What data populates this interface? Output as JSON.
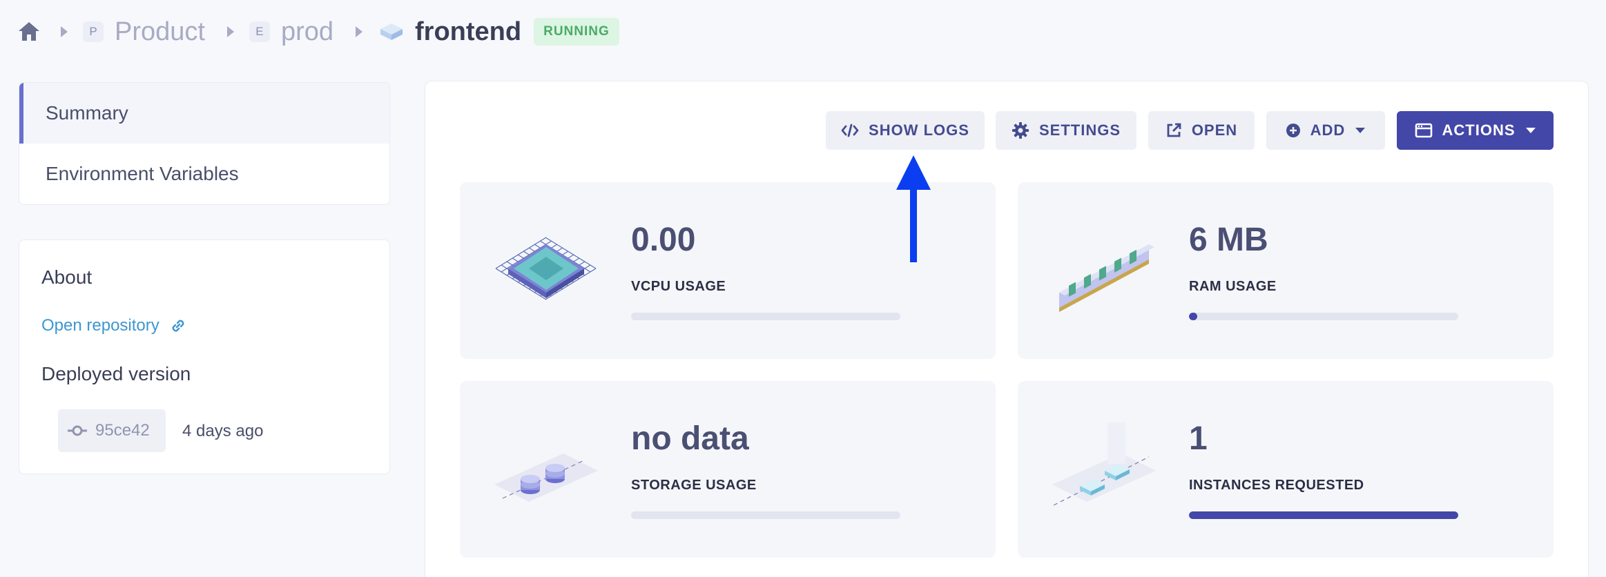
{
  "breadcrumb": {
    "project_letter": "P",
    "project": "Product",
    "env_letter": "E",
    "env": "prod",
    "service": "frontend",
    "status": "RUNNING"
  },
  "nav": {
    "items": [
      {
        "label": "Summary",
        "active": true
      },
      {
        "label": "Environment Variables",
        "active": false
      }
    ]
  },
  "about": {
    "title": "About",
    "repo_link": "Open repository",
    "deployed_title": "Deployed version",
    "commit": "95ce42",
    "deployed_ago": "4 days ago"
  },
  "toolbar": {
    "show_logs": "SHOW LOGS",
    "settings": "SETTINGS",
    "open": "OPEN",
    "add": "ADD",
    "actions": "ACTIONS"
  },
  "metrics": [
    {
      "value": "0.00",
      "label": "VCPU USAGE",
      "fill_fraction": 0
    },
    {
      "value": "6 MB",
      "label": "RAM USAGE",
      "fill_fraction": 0.02
    },
    {
      "value": "no data",
      "label": "STORAGE USAGE",
      "fill_fraction": 0
    },
    {
      "value": "1",
      "label": "INSTANCES REQUESTED",
      "fill_fraction": 1
    }
  ],
  "colors": {
    "accent": "#4347a8",
    "running_badge_bg": "#ddf5e3",
    "running_badge_text": "#4caa68",
    "annotation_arrow": "#0a3ef0"
  },
  "icons": {
    "home": "home-icon",
    "logs": "code-icon",
    "settings": "gear-icon",
    "open": "external-link-icon",
    "add": "plus-circle-icon",
    "actions": "window-icon",
    "commit": "git-commit-icon",
    "link": "link-icon"
  }
}
